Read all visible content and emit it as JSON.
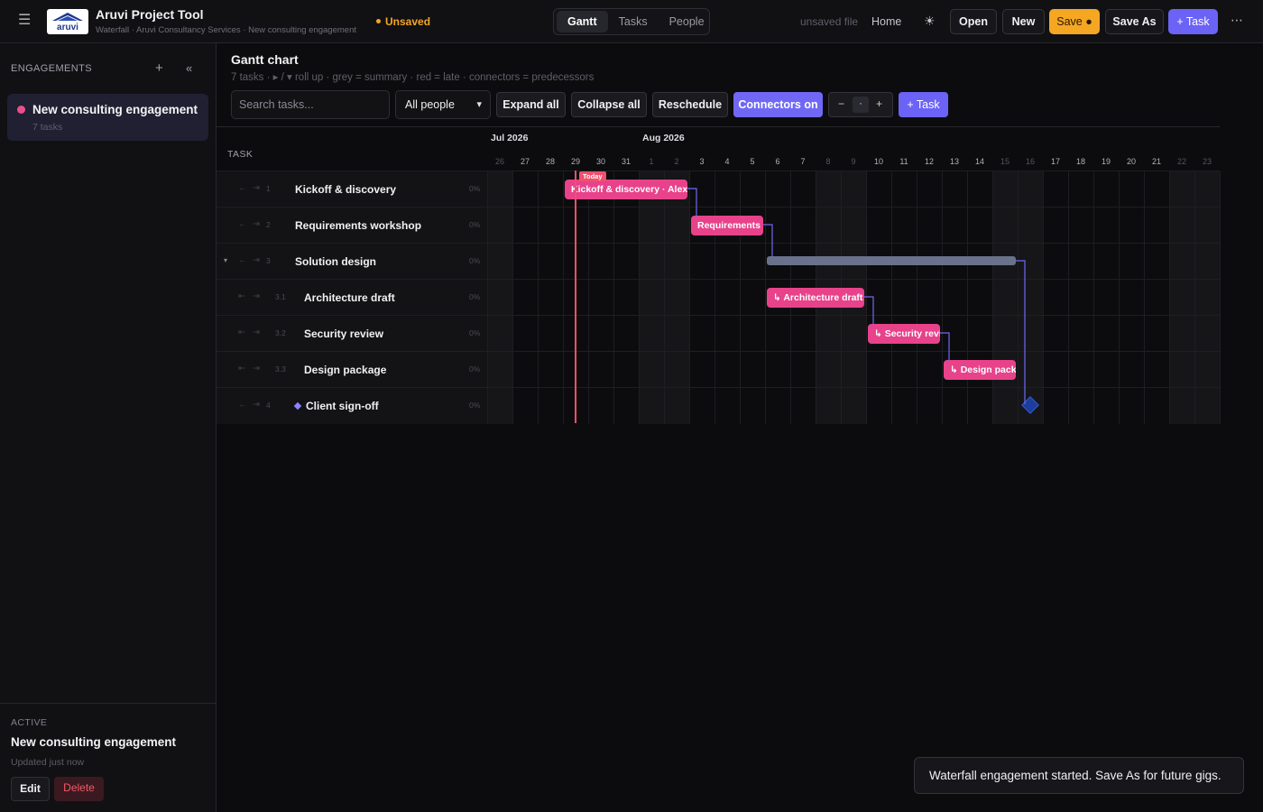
{
  "app": {
    "title": "Aruvi Project Tool",
    "subtitle": "Waterfall · Aruvi Consultancy Services · New consulting engagement",
    "logo_text": "aruvi",
    "status": "Unsaved",
    "file_status": "unsaved file"
  },
  "tabs": [
    "Gantt",
    "Tasks",
    "People"
  ],
  "active_tab": "Gantt",
  "toolbar": {
    "home": "Home",
    "open": "Open",
    "new": "New",
    "save": "Save ●",
    "save_as": "Save As",
    "add_task": "+ Task",
    "more": "⋯"
  },
  "sidebar": {
    "heading": "ENGAGEMENTS",
    "add": "+",
    "collapse": "«",
    "engagements": [
      {
        "name": "New consulting engagement",
        "count": "7 tasks",
        "color": "#ec4e8c"
      }
    ],
    "active": {
      "label": "ACTIVE",
      "name": "New consulting engagement",
      "updated": "Updated just now",
      "edit": "Edit",
      "delete": "Delete"
    }
  },
  "gantt": {
    "title": "Gantt chart",
    "subtitle": "7 tasks · ▸ / ▾  roll up · grey = summary · red = late · connectors = predecessors",
    "search_placeholder": "Search tasks...",
    "people_filter": "All people",
    "expand_all": "Expand all",
    "collapse_all": "Collapse all",
    "reschedule": "Reschedule",
    "connectors": "Connectors on",
    "zoom_out": "−",
    "zoom_level": "·",
    "zoom_in": "+",
    "add_task": "+ Task",
    "task_header": "TASK",
    "months": [
      {
        "label": "Jul 2026",
        "start_day": "26"
      },
      {
        "label": "Aug 2026",
        "start_day": "1"
      }
    ],
    "days": [
      {
        "d": "26",
        "weekend": true
      },
      {
        "d": "27",
        "weekend": false
      },
      {
        "d": "28",
        "weekend": false
      },
      {
        "d": "29",
        "weekend": false
      },
      {
        "d": "30",
        "weekend": false
      },
      {
        "d": "31",
        "weekend": false
      },
      {
        "d": "1",
        "weekend": true
      },
      {
        "d": "2",
        "weekend": true
      },
      {
        "d": "3",
        "weekend": false
      },
      {
        "d": "4",
        "weekend": false
      },
      {
        "d": "5",
        "weekend": false
      },
      {
        "d": "6",
        "weekend": false
      },
      {
        "d": "7",
        "weekend": false
      },
      {
        "d": "8",
        "weekend": true
      },
      {
        "d": "9",
        "weekend": true
      },
      {
        "d": "10",
        "weekend": false
      },
      {
        "d": "11",
        "weekend": false
      },
      {
        "d": "12",
        "weekend": false
      },
      {
        "d": "13",
        "weekend": false
      },
      {
        "d": "14",
        "weekend": false
      },
      {
        "d": "15",
        "weekend": true
      },
      {
        "d": "16",
        "weekend": true
      },
      {
        "d": "17",
        "weekend": false
      },
      {
        "d": "18",
        "weekend": false
      },
      {
        "d": "19",
        "weekend": false
      },
      {
        "d": "20",
        "weekend": false
      },
      {
        "d": "21",
        "weekend": false
      },
      {
        "d": "22",
        "weekend": true
      },
      {
        "d": "23",
        "weekend": true
      }
    ],
    "today_label": "Today",
    "today_index": 3,
    "tasks": [
      {
        "num": "1",
        "name": "Kickoff & discovery",
        "progress": "0%",
        "level": 0,
        "type": "task",
        "bar_label": "Kickoff & discovery · Alex",
        "start_index": 3,
        "duration_days": 5
      },
      {
        "num": "2",
        "name": "Requirements workshop",
        "progress": "0%",
        "level": 0,
        "type": "task",
        "bar_label": "Requirements",
        "start_index": 8,
        "duration_days": 3
      },
      {
        "num": "3",
        "name": "Solution design",
        "progress": "0%",
        "level": 0,
        "type": "summary",
        "bar_label": "",
        "start_index": 11,
        "duration_days": 10
      },
      {
        "num": "3.1",
        "name": "Architecture draft",
        "progress": "0%",
        "level": 1,
        "type": "task",
        "bar_label": "↳ Architecture draft",
        "start_index": 11,
        "duration_days": 4
      },
      {
        "num": "3.2",
        "name": "Security review",
        "progress": "0%",
        "level": 1,
        "type": "task",
        "bar_label": "↳ Security review",
        "start_index": 15,
        "duration_days": 3
      },
      {
        "num": "3.3",
        "name": "Design package",
        "progress": "0%",
        "level": 1,
        "type": "task",
        "bar_label": "↳ Design package",
        "start_index": 18,
        "duration_days": 3
      },
      {
        "num": "4",
        "name": "Client sign-off",
        "progress": "0%",
        "level": 0,
        "type": "milestone",
        "bar_label": "",
        "start_index": 21,
        "duration_days": 0
      }
    ],
    "dependencies": [
      [
        0,
        1
      ],
      [
        1,
        2
      ],
      [
        3,
        4
      ],
      [
        4,
        5
      ],
      [
        2,
        6
      ]
    ],
    "colors": {
      "task": "#e8428a",
      "summary": "#69728a",
      "milestone": "#1c3d9b",
      "today": "#f0506e",
      "connector": "#7068f5"
    }
  },
  "toast": "Waterfall engagement started. Save As for future gigs."
}
